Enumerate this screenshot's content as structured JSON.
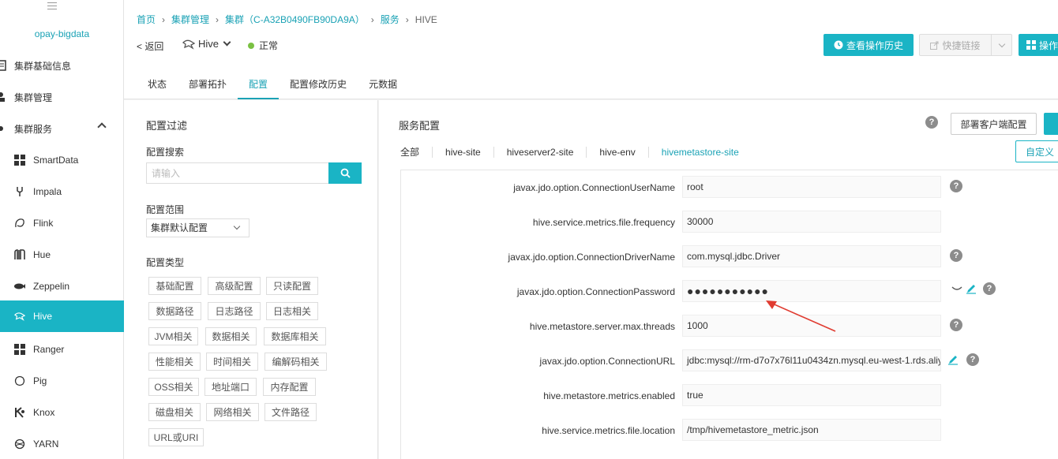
{
  "sidebar": {
    "cluster_name": "opay-bigdata",
    "items": [
      {
        "label": "集群基础信息",
        "icon": "cluster-info-icon"
      },
      {
        "label": "集群管理",
        "icon": "user-manage-icon"
      },
      {
        "label": "集群服务",
        "icon": "services-icon"
      },
      {
        "label": "SmartData",
        "icon": "grid-icon"
      },
      {
        "label": "Impala",
        "icon": "fork-icon"
      },
      {
        "label": "Flink",
        "icon": "flink-icon"
      },
      {
        "label": "Hue",
        "icon": "hue-icon"
      },
      {
        "label": "Zeppelin",
        "icon": "zeppelin-icon"
      },
      {
        "label": "Hive",
        "icon": "hive-icon"
      },
      {
        "label": "Ranger",
        "icon": "grid-icon"
      },
      {
        "label": "Pig",
        "icon": "pig-icon"
      },
      {
        "label": "Knox",
        "icon": "knox-icon"
      },
      {
        "label": "YARN",
        "icon": "yarn-icon"
      }
    ]
  },
  "breadcrumb": {
    "home": "首页",
    "cluster_mgmt": "集群管理",
    "cluster": "集群（C-A32B0490FB90DA9A）",
    "service": "服务",
    "current": "HIVE"
  },
  "header": {
    "back_label": "< 返回",
    "service_name": "Hive",
    "status_text": "正常",
    "status_color": "#7ac143",
    "history_button": "查看操作历史",
    "quick_link_button": "快捷链接",
    "ops_button": "操作"
  },
  "tabs": [
    "状态",
    "部署拓扑",
    "配置",
    "配置修改历史",
    "元数据"
  ],
  "active_tab": "配置",
  "filter": {
    "title": "配置过滤",
    "search_label": "配置搜索",
    "search_placeholder": "请输入",
    "scope_label": "配置范围",
    "scope_value": "集群默认配置",
    "type_label": "配置类型",
    "type_tags": [
      "基础配置",
      "高级配置",
      "只读配置",
      "数据路径",
      "日志路径",
      "日志相关",
      "JVM相关",
      "数据相关",
      "数据库相关",
      "性能相关",
      "时间相关",
      "编解码相关",
      "OSS相关",
      "地址端口",
      "内存配置",
      "磁盘相关",
      "网络相关",
      "文件路径",
      "URL或URI"
    ]
  },
  "config": {
    "title": "服务配置",
    "deploy_client_button": "部署客户端配置",
    "custom_button": "自定义",
    "subtabs": [
      "全部",
      "hive-site",
      "hiveserver2-site",
      "hive-env",
      "hivemetastore-site"
    ],
    "active_subtab": "hivemetastore-site",
    "rows": [
      {
        "key": "javax.jdo.option.ConnectionUserName",
        "value": "root"
      },
      {
        "key": "hive.service.metrics.file.frequency",
        "value": "30000"
      },
      {
        "key": "javax.jdo.option.ConnectionDriverName",
        "value": "com.mysql.jdbc.Driver"
      },
      {
        "key": "javax.jdo.option.ConnectionPassword",
        "value": "●●●●●●●●●●●"
      },
      {
        "key": "hive.metastore.server.max.threads",
        "value": "1000"
      },
      {
        "key": "javax.jdo.option.ConnectionURL",
        "value": "jdbc:mysql://rm-d7o7x76l11u0434zn.mysql.eu-west-1.rds.aliy"
      },
      {
        "key": "hive.metastore.metrics.enabled",
        "value": "true"
      },
      {
        "key": "hive.service.metrics.file.location",
        "value": "/tmp/hivemetastore_metric.json"
      }
    ]
  },
  "colors": {
    "accent": "#1ab4c5",
    "annotation_arrow": "#e03c31"
  }
}
